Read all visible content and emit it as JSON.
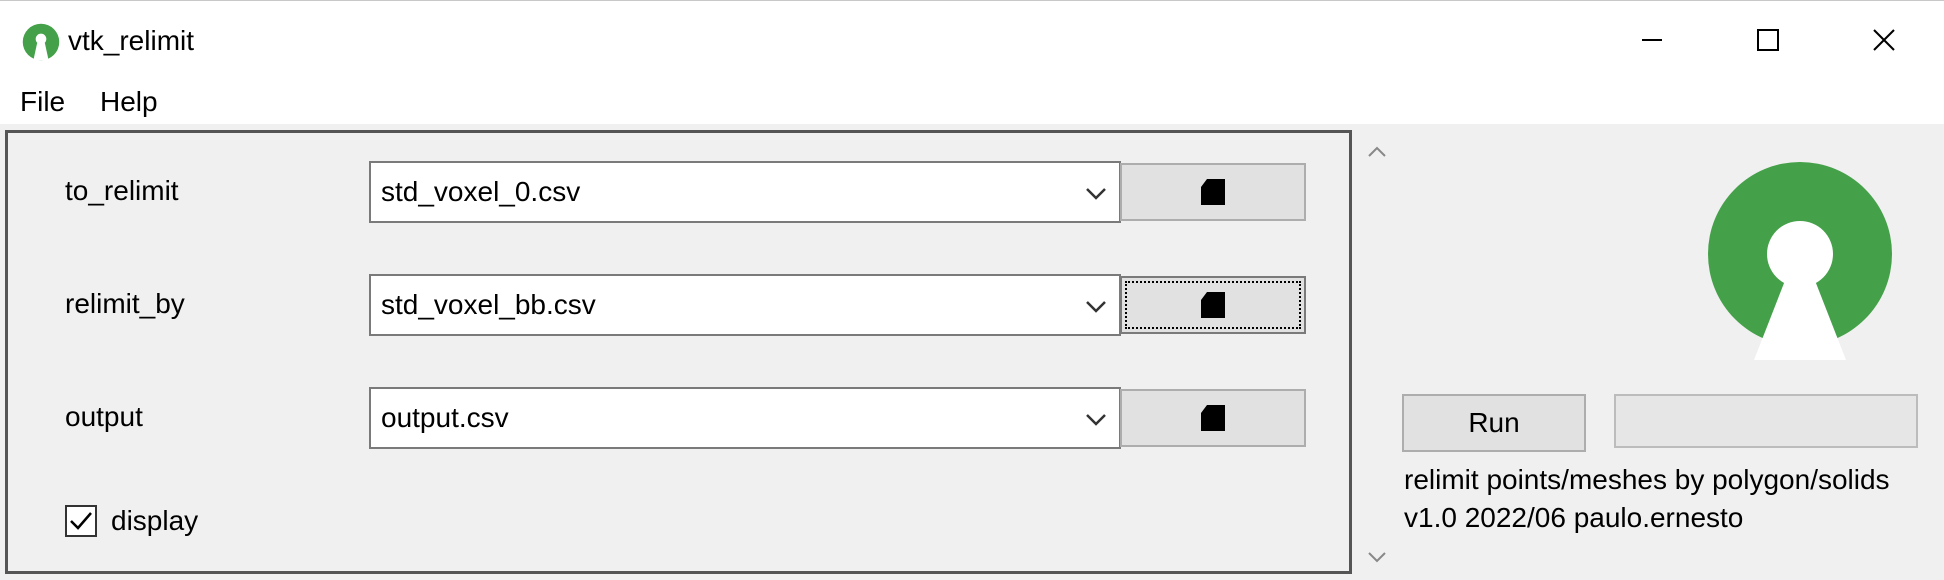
{
  "window": {
    "title": "vtk_relimit",
    "controls": {
      "minimize": "minimize-icon",
      "maximize": "maximize-icon",
      "close": "close-icon"
    }
  },
  "menu": {
    "file": "File",
    "help": "Help"
  },
  "form": {
    "rows": [
      {
        "label": "to_relimit",
        "value": "std_voxel_0.csv",
        "browse_icon": "file-open-icon"
      },
      {
        "label": "relimit_by",
        "value": "std_voxel_bb.csv",
        "browse_icon": "file-open-icon",
        "focused": true
      },
      {
        "label": "output",
        "value": "output.csv",
        "browse_icon": "file-open-icon"
      }
    ],
    "display_checkbox": {
      "label": "display",
      "checked": true
    }
  },
  "right_panel": {
    "run_label": "Run",
    "progress": 0,
    "info_line1": "relimit points/meshes by polygon/solids",
    "info_line2": "v1.0 2022/06 paulo.ernesto"
  },
  "colors": {
    "logo_green": "#44a149",
    "panel_bg": "#f0f0f0",
    "button_bg": "#e1e1e1"
  }
}
